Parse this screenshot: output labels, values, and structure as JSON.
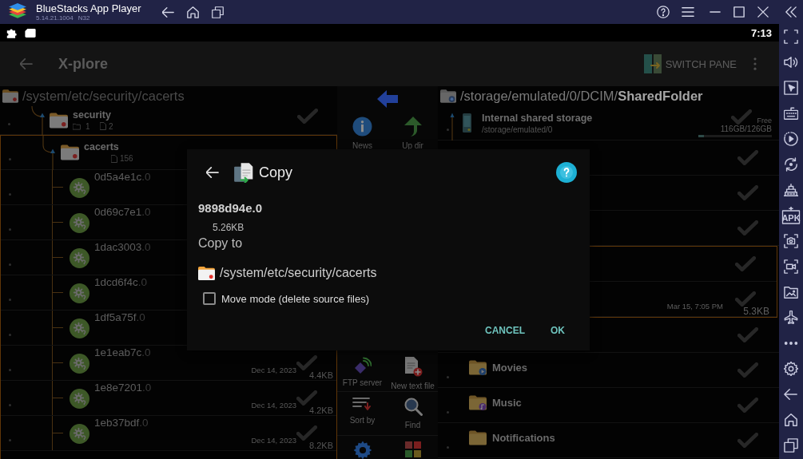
{
  "window": {
    "title": "BlueStacks App Player",
    "version": "5.14.21.1004",
    "build": "N32"
  },
  "status_bar": {
    "time": "7:13"
  },
  "app_bar": {
    "title": "X-plore",
    "action": "SWITCH PANE"
  },
  "left_pane": {
    "path": "/system/etc/security/cacerts",
    "tree": [
      {
        "kind": "folder",
        "name": "security",
        "folders": "1",
        "files": "2",
        "selected": false,
        "checked": false,
        "children": [
          {
            "kind": "folder",
            "name": "cacerts",
            "files": "156",
            "selected": true,
            "children": [
              {
                "kind": "file",
                "name": "0d5a4e1c.0",
                "selected": false
              },
              {
                "kind": "file",
                "name": "0d69c7e1.0",
                "selected": false
              },
              {
                "kind": "file",
                "name": "1dac3003.0",
                "selected": false
              },
              {
                "kind": "file",
                "name": "1dcd6f4c.0",
                "selected": false
              },
              {
                "kind": "file",
                "name": "1df5a75f.0",
                "selected": false
              },
              {
                "kind": "file",
                "name": "1e1eab7c.0",
                "date": "Dec 14, 2023",
                "size": "4.4KB",
                "checked": false,
                "selected": false
              },
              {
                "kind": "file",
                "name": "1e8e7201.0",
                "date": "Dec 14, 2023",
                "size": "4.2KB",
                "checked": false,
                "selected": false
              },
              {
                "kind": "file",
                "name": "1eb37bdf.0",
                "date": "Dec 14, 2023",
                "size": "8.2KB",
                "checked": false,
                "selected": false
              }
            ]
          }
        ]
      }
    ]
  },
  "toolbar": {
    "buttons": [
      {
        "kind": "news",
        "label": "News"
      },
      {
        "kind": "up",
        "label": "Up dir"
      },
      {
        "kind": "ftp",
        "label": "FTP server"
      },
      {
        "kind": "new_text",
        "label": "New text file"
      },
      {
        "kind": "sort",
        "label": "Sort by"
      },
      {
        "kind": "find",
        "label": "Find"
      },
      {
        "kind": "settings"
      },
      {
        "kind": "tools"
      }
    ]
  },
  "right_pane": {
    "path": "/storage/emulated/0/DCIM/**SharedFolder**",
    "tree": [
      {
        "kind": "storage",
        "name": "Internal shared storage",
        "path": "/storage/emulated/0",
        "free_label": "Free",
        "space": "116GB/126GB",
        "level": 0.08,
        "checked": false,
        "selected": false,
        "children": [
          {
            "checked": false,
            "selected": false
          },
          {
            "checked": false,
            "selected": false
          },
          {
            "checked": false,
            "selected": false
          },
          {
            "checked": false,
            "selected": true,
            "children": [
              {
                "kind": "file",
                "date": "Mar 15, 7:05 PM",
                "size": "5.3KB",
                "checked": false,
                "selected": false
              }
            ]
          },
          {
            "checked": false,
            "selected": false
          },
          {
            "kind": "video_folder",
            "name": "Movies",
            "checked": false,
            "selected": false
          },
          {
            "kind": "music_folder",
            "name": "Music",
            "checked": false,
            "selected": false
          },
          {
            "kind": "folder",
            "name": "Notifications",
            "checked": false,
            "selected": false
          }
        ]
      }
    ]
  },
  "dialog": {
    "title": "Copy",
    "file_name": "9898d94e.0",
    "file_size": "5.26KB",
    "target_label": "Copy to",
    "target_path": "/system/etc/security/cacerts",
    "move_mode": {
      "label": "Move mode (delete source files)",
      "checked": false
    },
    "buttons": [
      {
        "label": "CANCEL"
      },
      {
        "label": "OK"
      }
    ]
  },
  "sidebar": {
    "apk_label": "APK"
  }
}
